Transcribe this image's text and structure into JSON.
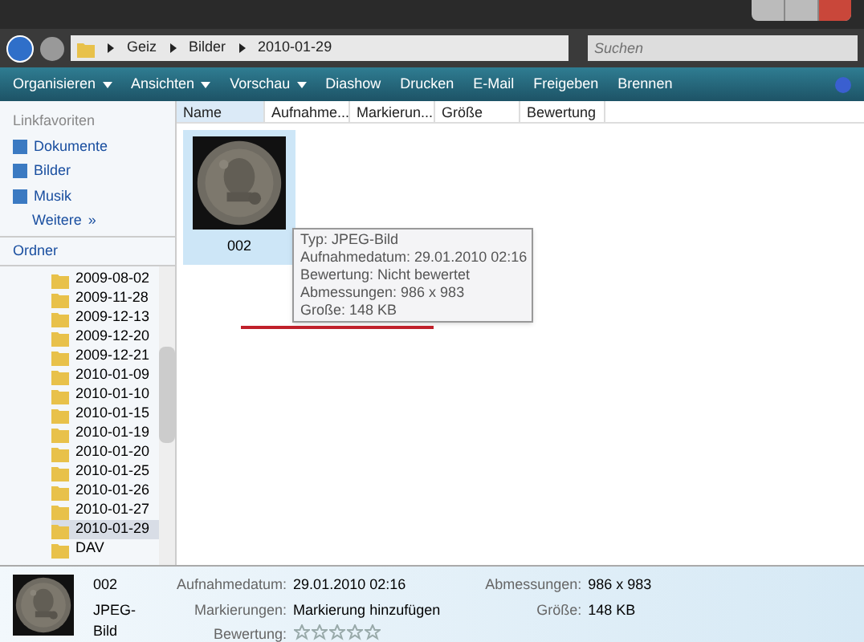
{
  "address": {
    "crumbs": [
      "Geiz",
      "Bilder",
      "2010-01-29"
    ]
  },
  "search": {
    "placeholder": "Suchen"
  },
  "toolbar": [
    {
      "label": "Organisieren",
      "kind": "menu"
    },
    {
      "label": "Ansichten",
      "kind": "menu"
    },
    {
      "label": "Vorschau",
      "kind": "menu"
    },
    {
      "label": "Diashow",
      "kind": "plain"
    },
    {
      "label": "Drucken",
      "kind": "plain"
    },
    {
      "label": "E-Mail",
      "kind": "plain"
    },
    {
      "label": "Freigeben",
      "kind": "plain"
    },
    {
      "label": "Brennen",
      "kind": "plain"
    }
  ],
  "favorites": {
    "title": "Linkfavoriten",
    "items": [
      "Dokumente",
      "Bilder",
      "Musik"
    ],
    "more": "Weitere",
    "more_glyph": "»"
  },
  "folders": {
    "title": "Ordner",
    "items": [
      {
        "label": "2009-08-02",
        "selected": false
      },
      {
        "label": "2009-11-28",
        "selected": false
      },
      {
        "label": "2009-12-13",
        "selected": false
      },
      {
        "label": "2009-12-20",
        "selected": false
      },
      {
        "label": "2009-12-21",
        "selected": false
      },
      {
        "label": "2010-01-09",
        "selected": false
      },
      {
        "label": "2010-01-10",
        "selected": false
      },
      {
        "label": "2010-01-15",
        "selected": false
      },
      {
        "label": "2010-01-19",
        "selected": false
      },
      {
        "label": "2010-01-20",
        "selected": false
      },
      {
        "label": "2010-01-25",
        "selected": false
      },
      {
        "label": "2010-01-26",
        "selected": false
      },
      {
        "label": "2010-01-27",
        "selected": false
      },
      {
        "label": "2010-01-29",
        "selected": true
      },
      {
        "label": "DAV",
        "selected": false
      }
    ]
  },
  "columns": [
    "Name",
    "Aufnahme...",
    "Markierun...",
    "Größe",
    "Bewertung"
  ],
  "files": [
    {
      "name": "002",
      "kind": "picture",
      "selected": true
    }
  ],
  "tooltip": [
    "Typ: JPEG-Bild",
    "Aufnahmedatum: 29.01.2010 02:16",
    "Bewertung: Nicht bewertet",
    "Abmessungen: 986 x 983",
    "Große: 148 KB"
  ],
  "details": {
    "name": "002",
    "type": "JPEG-Bild",
    "fields": [
      {
        "label": "Aufnahmedatum:",
        "value": "29.01.2010 02:16"
      },
      {
        "label": "Markierungen:",
        "value": "Markierung hinzufügen"
      },
      {
        "label": "Bewertung:",
        "stars": 0
      }
    ],
    "fields2": [
      {
        "label": "Abmessungen:",
        "value": "986 x 983"
      },
      {
        "label": "Größe:",
        "value": "148 KB"
      }
    ]
  }
}
